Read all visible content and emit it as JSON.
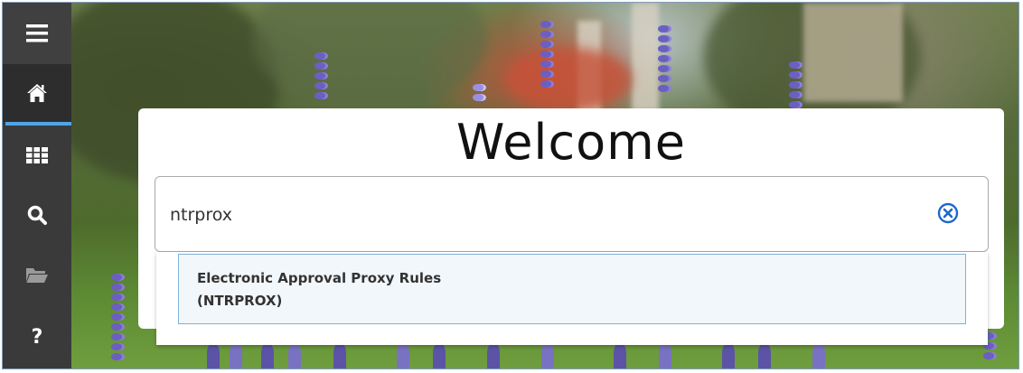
{
  "nav": {
    "items": [
      {
        "icon": "menu-icon"
      },
      {
        "icon": "home-icon",
        "active": true
      },
      {
        "icon": "applications-icon"
      },
      {
        "icon": "search-icon"
      },
      {
        "icon": "recent-folder-icon"
      },
      {
        "icon": "help-icon",
        "glyph": "?"
      }
    ]
  },
  "welcome": {
    "title": "Welcome"
  },
  "search": {
    "value": "ntrprox",
    "clear_icon": "clear-circle-x-icon"
  },
  "results": [
    {
      "name": "Electronic Approval Proxy Rules",
      "code": "(NTRPROX)"
    }
  ],
  "colors": {
    "rail": "#3a3a3a",
    "active_indicator": "#4fa4e6",
    "clear_icon": "#1d69c9",
    "result_border": "#7fb0d6"
  }
}
